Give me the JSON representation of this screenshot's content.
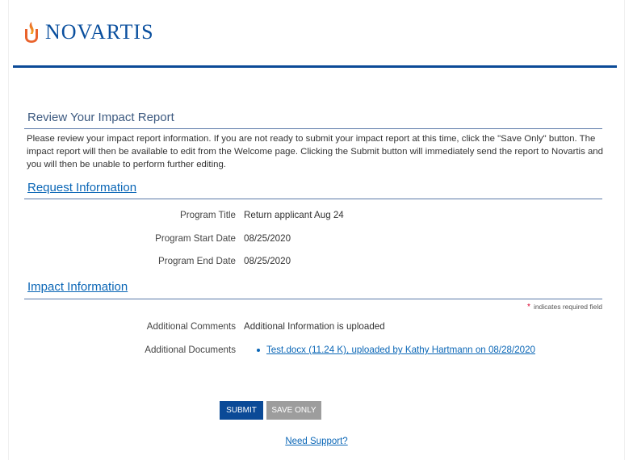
{
  "brand": {
    "name": "NOVARTIS",
    "logo_icon": "novartis-flame-icon",
    "colors": {
      "primary": "#0b4a97",
      "flame_top": "#e9622b",
      "flame_bottom": "#f3a420",
      "link": "#0a66b6"
    }
  },
  "review": {
    "title": "Review Your Impact Report",
    "intro": "Please review your impact report information. If you are not ready to submit your impact report at this time, click the \"Save Only\" button. The impact report will then be available to edit from the Welcome page. Clicking the Submit button will immediately send the report to Novartis and you will then be unable to perform further editing."
  },
  "request": {
    "title": "Request Information",
    "fields": [
      {
        "label": "Program Title",
        "value": "Return applicant Aug 24"
      },
      {
        "label": "Program Start Date",
        "value": "08/25/2020"
      },
      {
        "label": "Program End Date",
        "value": "08/25/2020"
      }
    ]
  },
  "impact": {
    "title": "Impact Information",
    "required_star": "*",
    "required_note": "indicates required field",
    "comments_label": "Additional Comments",
    "comments_value": "Additional Information is uploaded",
    "documents_label": "Additional Documents",
    "documents": [
      {
        "text": "Test.docx (11.24 K), uploaded by Kathy Hartmann on 08/28/2020"
      }
    ]
  },
  "actions": {
    "submit_label": "SUBMIT",
    "save_label": "SAVE ONLY"
  },
  "support": {
    "label": "Need Support?"
  }
}
